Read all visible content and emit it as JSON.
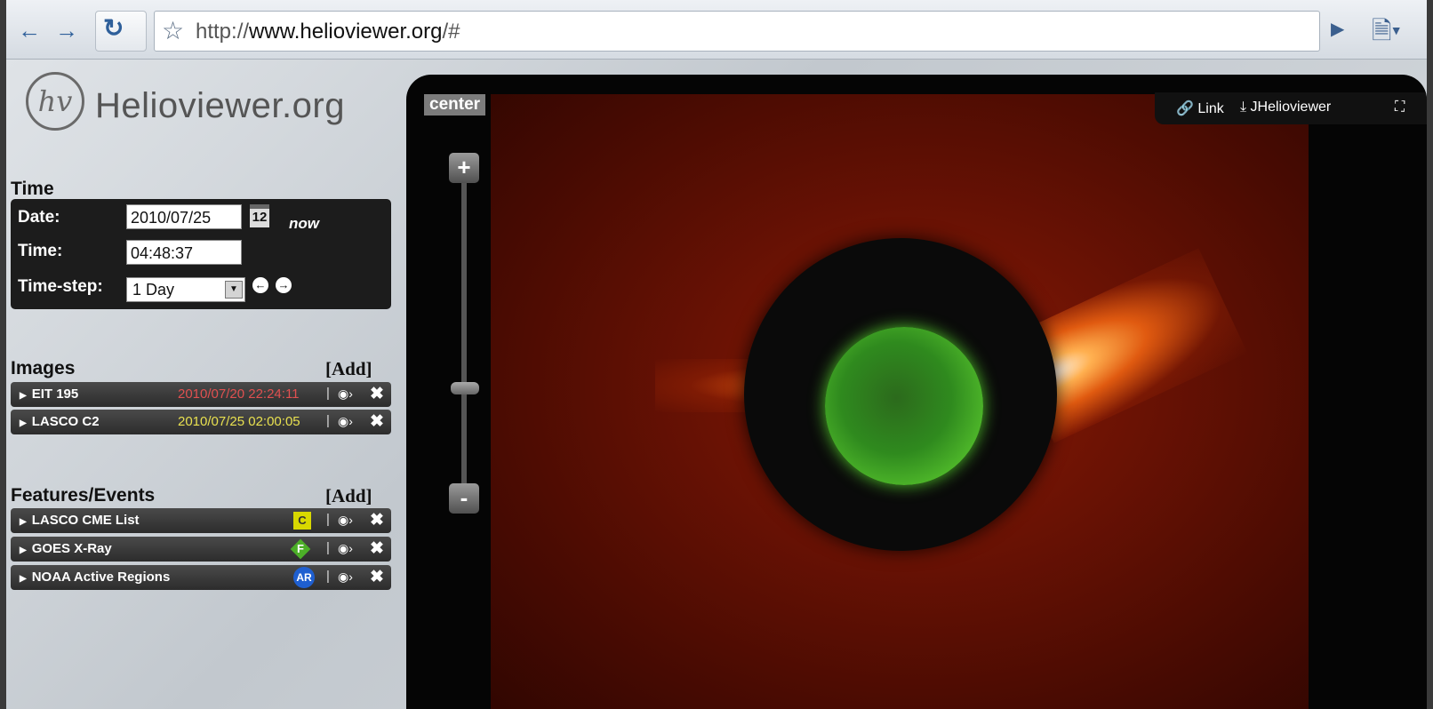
{
  "browser": {
    "url_prefix": "http://",
    "url_host": "www.helioviewer.org",
    "url_suffix": "/#"
  },
  "logo": {
    "mark": "hv",
    "text": "Helioviewer.org"
  },
  "time": {
    "heading": "Time",
    "date_label": "Date:",
    "date_value": "2010/07/25",
    "calendar_day": "12",
    "now_label": "now",
    "time_label": "Time:",
    "time_value": "04:48:37",
    "step_label": "Time-step:",
    "step_value": "1 Day"
  },
  "images": {
    "heading": "Images",
    "add_label": "[Add]",
    "layers": [
      {
        "name": "EIT 195",
        "date": "2010/07/20 22:24:11",
        "date_color": "#e05050"
      },
      {
        "name": "LASCO C2",
        "date": "2010/07/25 02:00:05",
        "date_color": "#e8e050"
      }
    ]
  },
  "features": {
    "heading": "Features/Events",
    "add_label": "[Add]",
    "items": [
      {
        "name": "LASCO CME List",
        "badge": "C"
      },
      {
        "name": "GOES X-Ray",
        "badge": "F"
      },
      {
        "name": "NOAA Active Regions",
        "badge": "AR"
      }
    ]
  },
  "viewer": {
    "center_label": "center",
    "link_label": "Link",
    "jhv_label": "JHelioviewer",
    "zoom_in": "+",
    "zoom_out": "-"
  },
  "separator": "|"
}
